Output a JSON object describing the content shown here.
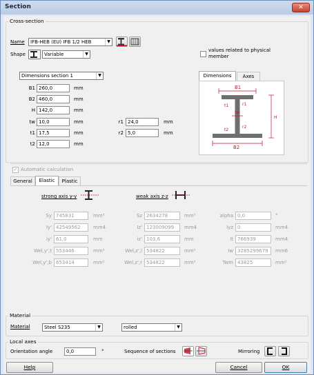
{
  "window": {
    "title": "Section",
    "close_glyph": "✕"
  },
  "cross_section": {
    "group_label": "Cross-section",
    "name_label": "Name",
    "name_value": "IFB-HEB (EU) IFB 1/2 HEB",
    "shape_label": "Shape",
    "shape_value": "Variable",
    "physical_member_label": "values related to physical member",
    "dims_section_value": "Dimensions section 1",
    "dimensions": [
      {
        "label": "B1",
        "value": "260,0",
        "unit": "mm"
      },
      {
        "label": "B2",
        "value": "460,0",
        "unit": "mm"
      },
      {
        "label": "H",
        "value": "142,0",
        "unit": "mm"
      },
      {
        "label": "tw",
        "value": "10,0",
        "unit": "mm"
      },
      {
        "label": "t1",
        "value": "17,5",
        "unit": "mm"
      },
      {
        "label": "t2",
        "value": "12,0",
        "unit": "mm"
      }
    ],
    "radii": [
      {
        "label": "r1",
        "value": "24,0",
        "unit": "mm"
      },
      {
        "label": "r2",
        "value": "5,0",
        "unit": "mm"
      }
    ],
    "preview_tabs": [
      "Dimensions",
      "Axes"
    ],
    "preview_labels": {
      "b1": "B1",
      "b2": "B2",
      "h": "H",
      "t1": "t1",
      "t2": "t2",
      "tw": "tw",
      "r1": "r1",
      "r2": "r2"
    }
  },
  "properties": {
    "auto_calc_label": "Automatic calculation",
    "tabs": [
      "General",
      "Elastic",
      "Plastic"
    ],
    "strong_axis_label": "strong axis y-y",
    "weak_axis_label": "weak axis z-z",
    "col1": [
      {
        "label": "Sy",
        "value": "745831",
        "unit": "mm³"
      },
      {
        "label": "Iy'",
        "value": "42549562",
        "unit": "mm4"
      },
      {
        "label": "iy'",
        "value": "61,0",
        "unit": "mm"
      },
      {
        "label": "Wel,y',t",
        "value": "553446",
        "unit": "mm³"
      },
      {
        "label": "Wel,y',b",
        "value": "653414",
        "unit": "mm³"
      }
    ],
    "col2": [
      {
        "label": "Sz",
        "value": "2634278",
        "unit": "mm³"
      },
      {
        "label": "Iz'",
        "value": "123009099",
        "unit": "mm4"
      },
      {
        "label": "iz'",
        "value": "103,6",
        "unit": "mm"
      },
      {
        "label": "Wel,z',l",
        "value": "534822",
        "unit": "mm³"
      },
      {
        "label": "Wel,z',r",
        "value": "534822",
        "unit": "mm³"
      }
    ],
    "col3": [
      {
        "label": "alpha",
        "value": "0,0",
        "unit": "°"
      },
      {
        "label": "Iyz",
        "value": "0",
        "unit": "mm4"
      },
      {
        "label": "It",
        "value": "766939",
        "unit": "mm4"
      },
      {
        "label": "Iw",
        "value": "3285299679",
        "unit": "mm6"
      },
      {
        "label": "Twm",
        "value": "43825",
        "unit": "mm³"
      }
    ]
  },
  "material": {
    "group_label": "Material",
    "label": "Material",
    "value": "Steel S235",
    "type_value": "rolled"
  },
  "local_axes": {
    "group_label": "Local axes",
    "orientation_label": "Orientation angle",
    "orientation_value": "0,0",
    "orientation_unit": "°",
    "sequence_label": "Sequence of sections",
    "mirroring_label": "Mirroring"
  },
  "buttons": {
    "help": "Help",
    "cancel": "Cancel",
    "ok": "OK"
  },
  "colors": {
    "accent_red": "#c8102e",
    "beam_gray": "#6f6f6f"
  }
}
